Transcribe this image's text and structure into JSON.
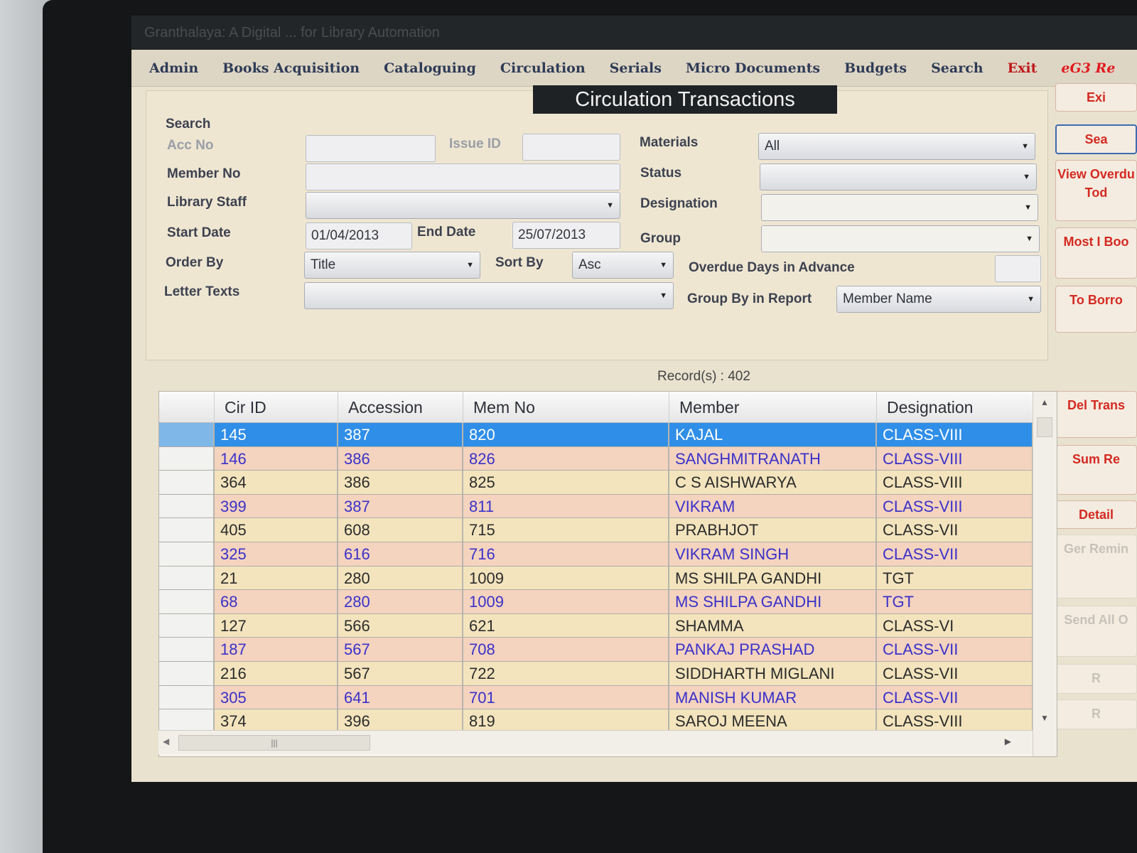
{
  "window": {
    "title": "Granthalaya: A Digital ... for Library Automation"
  },
  "menu": [
    {
      "label": "Admin",
      "style": "normal"
    },
    {
      "label": "Books Acquisition",
      "style": "normal"
    },
    {
      "label": "Cataloguing",
      "style": "normal"
    },
    {
      "label": "Circulation",
      "style": "normal"
    },
    {
      "label": "Serials",
      "style": "normal"
    },
    {
      "label": "Micro Documents",
      "style": "normal"
    },
    {
      "label": "Budgets",
      "style": "normal"
    },
    {
      "label": "Search",
      "style": "normal"
    },
    {
      "label": "Exit",
      "style": "red"
    },
    {
      "label": "eG3 Re",
      "style": "brand"
    }
  ],
  "page_title": "Circulation Transactions",
  "form": {
    "search_label": "Search",
    "acc_no_label": "Acc No",
    "acc_no_value": "",
    "issue_id_label": "Issue ID",
    "issue_id_value": "",
    "member_no_label": "Member No",
    "member_no_value": "",
    "library_staff_label": "Library Staff",
    "library_staff_value": "",
    "start_date_label": "Start Date",
    "start_date_value": "01/04/2013",
    "end_date_label": "End Date",
    "end_date_value": "25/07/2013",
    "order_by_label": "Order By",
    "order_by_value": "Title",
    "sort_by_label": "Sort By",
    "sort_by_value": "Asc",
    "letter_texts_label": "Letter Texts",
    "letter_texts_value": "",
    "materials_label": "Materials",
    "materials_value": "All",
    "status_label": "Status",
    "status_value": "",
    "designation_label": "Designation",
    "designation_value": "",
    "group_label": "Group",
    "group_value": "",
    "overdue_label": "Overdue Days in Advance",
    "overdue_value": "",
    "group_by_label": "Group By in Report",
    "group_by_value": "Member Name"
  },
  "side_buttons": [
    {
      "label": "Exi",
      "state": "normal"
    },
    {
      "label": "Sea",
      "state": "focused"
    },
    {
      "label": "View Overdu Tod",
      "state": "normal"
    },
    {
      "label": "Most I Boo",
      "state": "normal"
    },
    {
      "label": "To Borro",
      "state": "normal"
    },
    {
      "label": "Del Trans",
      "state": "normal"
    },
    {
      "label": "Sum Re",
      "state": "normal"
    },
    {
      "label": "Detail",
      "state": "normal"
    },
    {
      "label": "Ger Remin",
      "state": "disabled"
    },
    {
      "label": "Send All O",
      "state": "disabled"
    },
    {
      "label": "R",
      "state": "disabled"
    },
    {
      "label": "R",
      "state": "disabled"
    }
  ],
  "records_text": "Record(s) : 402",
  "grid": {
    "columns": [
      "Cir ID",
      "Accession",
      "Mem No",
      "Member",
      "Designation"
    ],
    "rows": [
      {
        "cir_id": "145",
        "accession": "387",
        "mem_no": "820",
        "member": "KAJAL",
        "designation": "CLASS-VIII",
        "style": "sel"
      },
      {
        "cir_id": "146",
        "accession": "386",
        "mem_no": "826",
        "member": "SANGHMITRANATH",
        "designation": "CLASS-VIII",
        "style": "pink"
      },
      {
        "cir_id": "364",
        "accession": "386",
        "mem_no": "825",
        "member": "C S AISHWARYA",
        "designation": "CLASS-VIII",
        "style": "yellow"
      },
      {
        "cir_id": "399",
        "accession": "387",
        "mem_no": "811",
        "member": "VIKRAM",
        "designation": "CLASS-VIII",
        "style": "pink"
      },
      {
        "cir_id": "405",
        "accession": "608",
        "mem_no": "715",
        "member": "PRABHJOT",
        "designation": "CLASS-VII",
        "style": "yellow"
      },
      {
        "cir_id": "325",
        "accession": "616",
        "mem_no": "716",
        "member": "VIKRAM SINGH",
        "designation": "CLASS-VII",
        "style": "pink"
      },
      {
        "cir_id": "21",
        "accession": "280",
        "mem_no": "1009",
        "member": "MS SHILPA GANDHI",
        "designation": "TGT",
        "style": "yellow"
      },
      {
        "cir_id": "68",
        "accession": "280",
        "mem_no": "1009",
        "member": "MS SHILPA GANDHI",
        "designation": "TGT",
        "style": "pink"
      },
      {
        "cir_id": "127",
        "accession": "566",
        "mem_no": "621",
        "member": "SHAMMA",
        "designation": "CLASS-VI",
        "style": "yellow"
      },
      {
        "cir_id": "187",
        "accession": "567",
        "mem_no": "708",
        "member": "PANKAJ PRASHAD",
        "designation": "CLASS-VII",
        "style": "pink"
      },
      {
        "cir_id": "216",
        "accession": "567",
        "mem_no": "722",
        "member": "SIDDHARTH MIGLANI",
        "designation": "CLASS-VII",
        "style": "yellow"
      },
      {
        "cir_id": "305",
        "accession": "641",
        "mem_no": "701",
        "member": "MANISH KUMAR",
        "designation": "CLASS-VII",
        "style": "pink"
      },
      {
        "cir_id": "374",
        "accession": "396",
        "mem_no": "819",
        "member": "SAROJ MEENA",
        "designation": "CLASS-VIII",
        "style": "yellow"
      }
    ]
  }
}
